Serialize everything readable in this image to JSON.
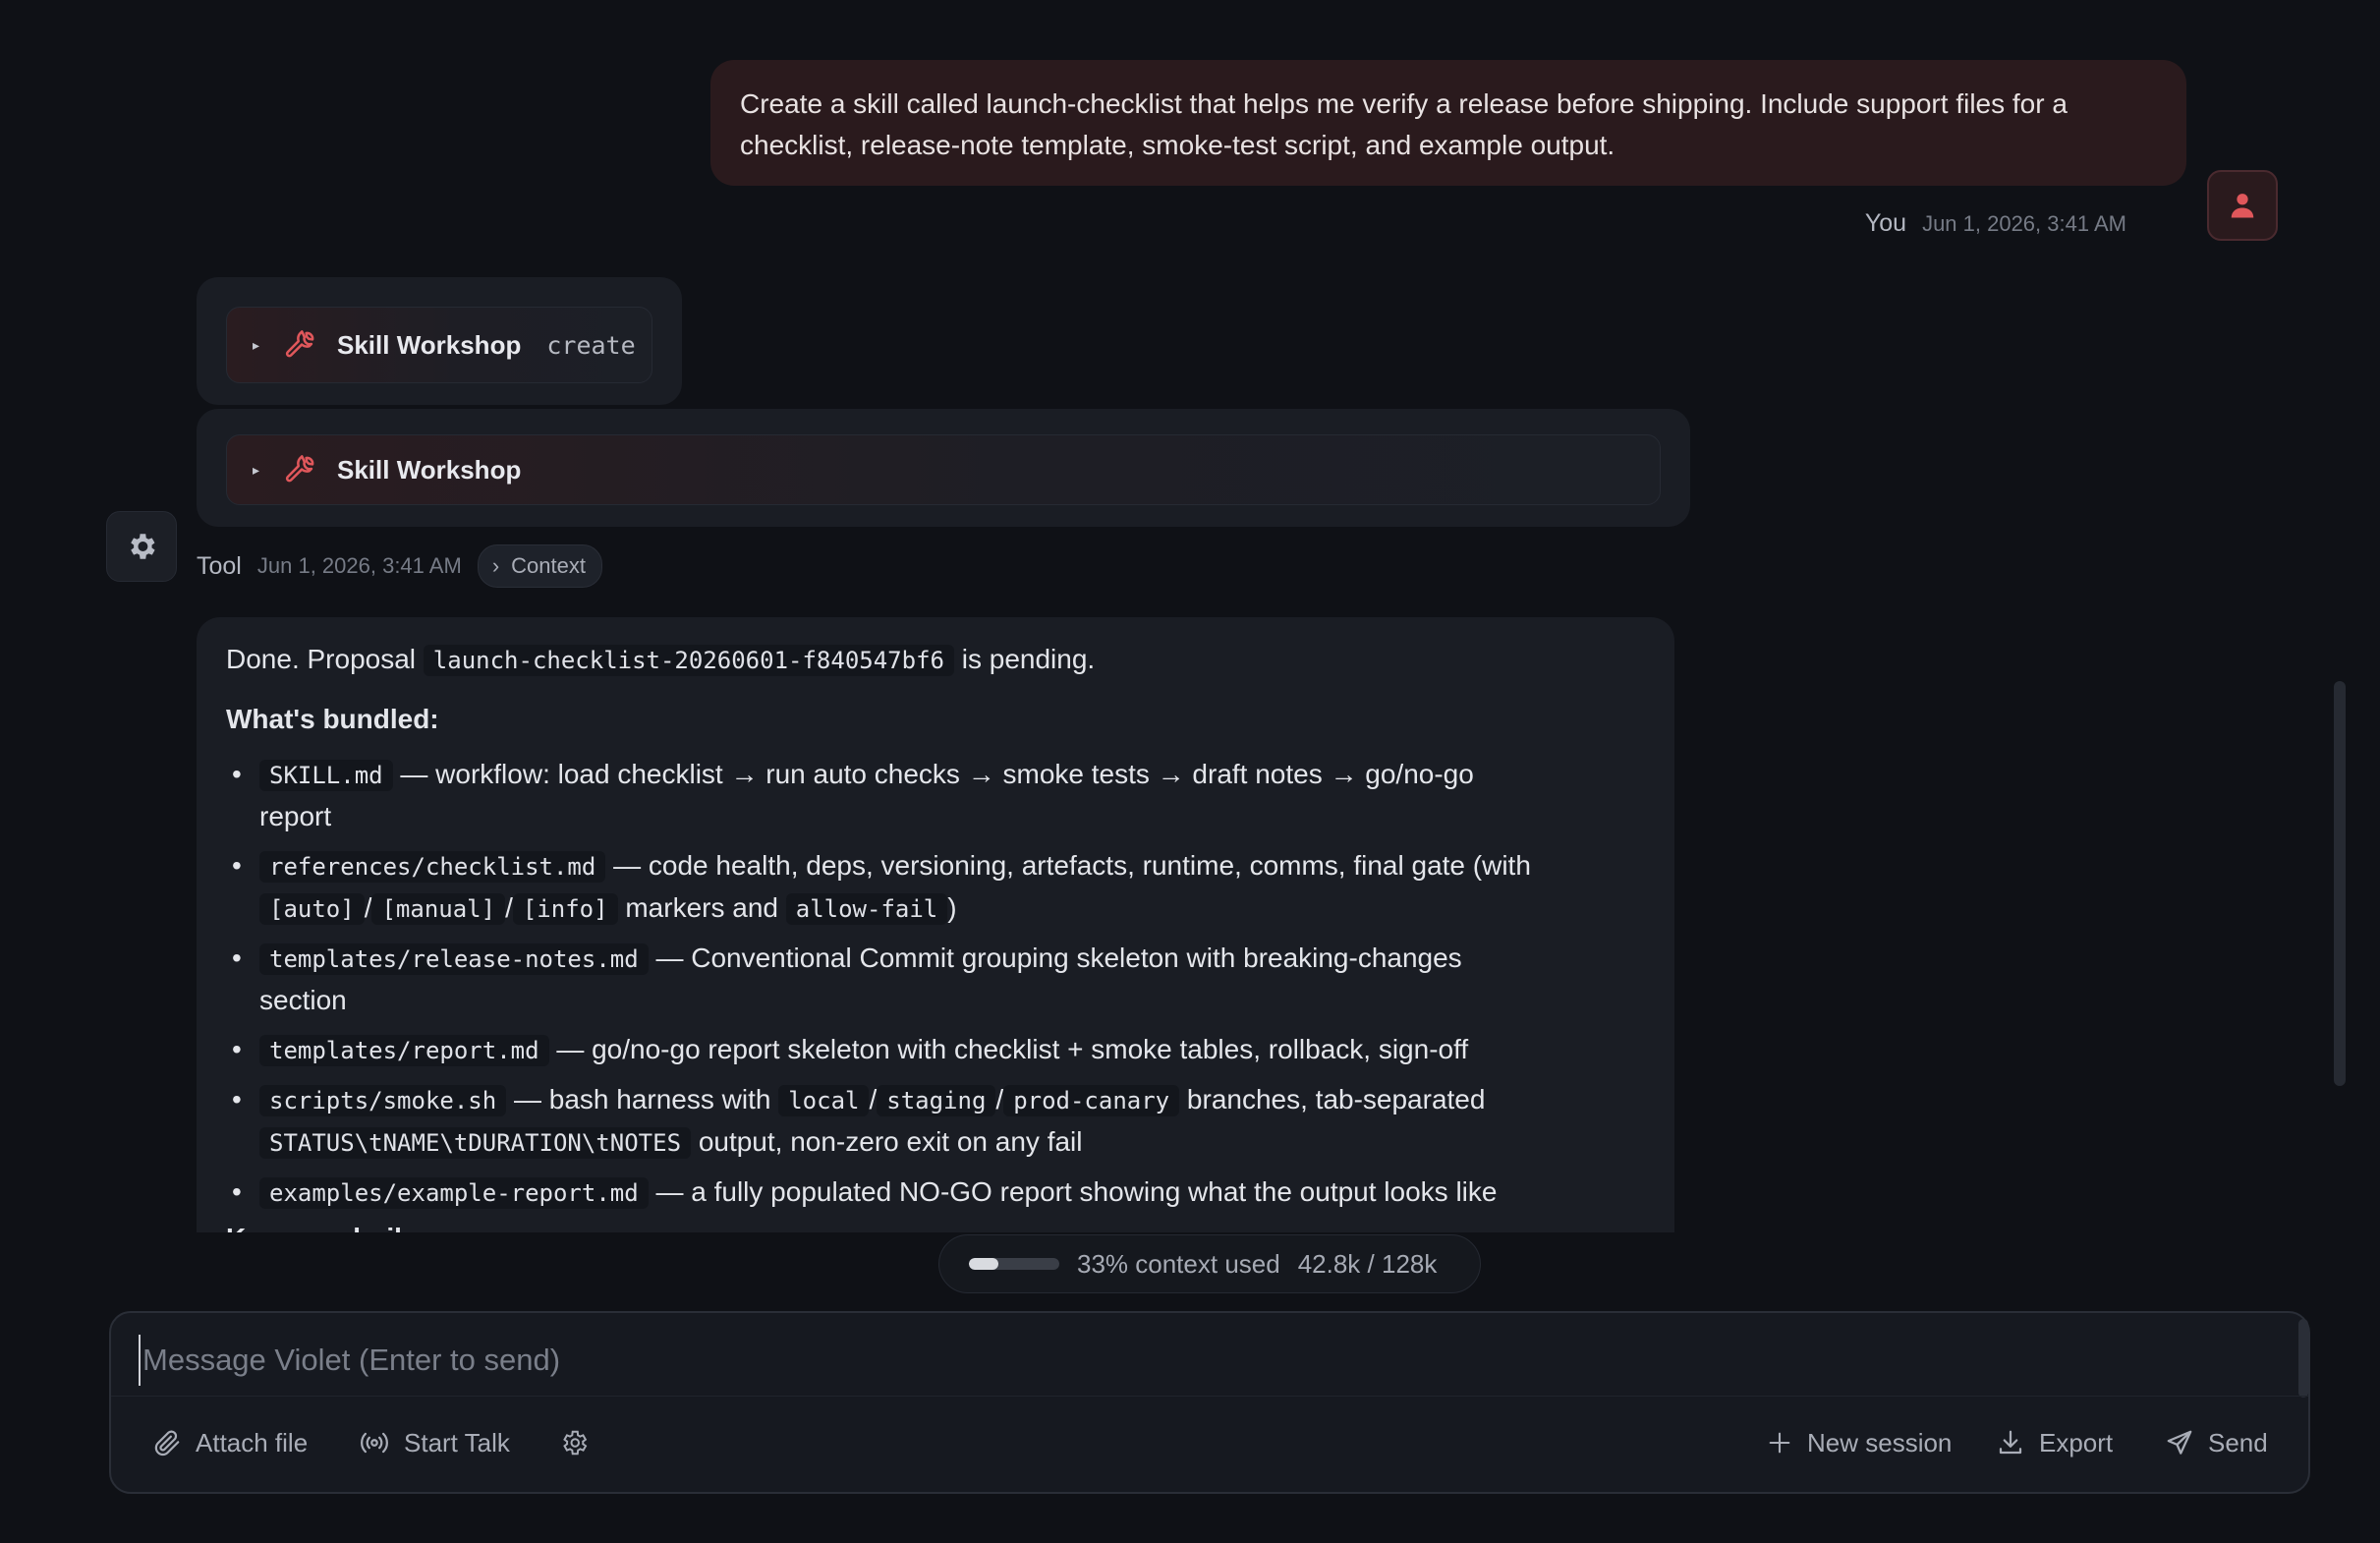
{
  "user_message": {
    "text": "Create a skill called launch-checklist that helps me verify a release before shipping. Include support files for a checklist, release-note template, smoke-test script, and example output.",
    "author": "You",
    "timestamp": "Jun 1, 2026, 3:41 AM"
  },
  "tool_calls": [
    {
      "name": "Skill Workshop",
      "arg": "create"
    },
    {
      "name": "Skill Workshop",
      "arg": ""
    }
  ],
  "tool_meta": {
    "author": "Tool",
    "timestamp": "Jun 1, 2026, 3:41 AM",
    "context_label": "Context"
  },
  "assistant": {
    "intro_prefix": "Done. Proposal",
    "proposal_id": "launch-checklist-20260601-f840547bf6",
    "intro_suffix": "is pending.",
    "bundled_heading": "What's bundled:",
    "items": [
      {
        "file": "SKILL.md",
        "desc": "— workflow: load checklist → run auto checks → smoke tests → draft notes → go/no-go report"
      },
      {
        "file": "references/checklist.md",
        "desc": "— code health, deps, versioning, artefacts, runtime, comms, final gate (with",
        "codes": [
          "[auto]",
          "/",
          "[manual]",
          "/",
          "[info]"
        ],
        "mid": "markers and",
        "tail_code": "allow-fail",
        "tail": ")"
      },
      {
        "file": "templates/release-notes.md",
        "desc": "— Conventional Commit grouping skeleton with breaking-changes section"
      },
      {
        "file": "templates/report.md",
        "desc": "— go/no-go report skeleton with checklist + smoke tables, rollback, sign-off"
      },
      {
        "file": "scripts/smoke.sh",
        "desc_a": "— bash harness with",
        "codes": [
          "local",
          "/",
          "staging",
          "/",
          "prod-canary"
        ],
        "desc_b": "branches, tab-separated",
        "code2": "STATUS\\tNAME\\tDURATION\\tNOTES",
        "desc_c": "output, non-zero exit on any fail"
      },
      {
        "file": "examples/example-report.md",
        "desc": "— a fully populated NO-GO report showing what the output looks like"
      }
    ],
    "guardrails_heading": "Key guardrails:"
  },
  "context_usage": {
    "percent_label": "33% context used",
    "tokens": "42.8k / 128k",
    "fraction": 0.33
  },
  "composer": {
    "placeholder": "Message Violet (Enter to send)",
    "attach": "Attach file",
    "talk": "Start Talk",
    "new_session": "New session",
    "export": "Export",
    "send": "Send"
  },
  "icons": {
    "tool": "wrench-icon",
    "tool_avatar": "gear-icon",
    "user_avatar": "person-icon"
  },
  "colors": {
    "accent": "#e0575b",
    "background": "#0f1116",
    "surface": "#1a1d24",
    "user_bubble": "#2a1a1d"
  }
}
